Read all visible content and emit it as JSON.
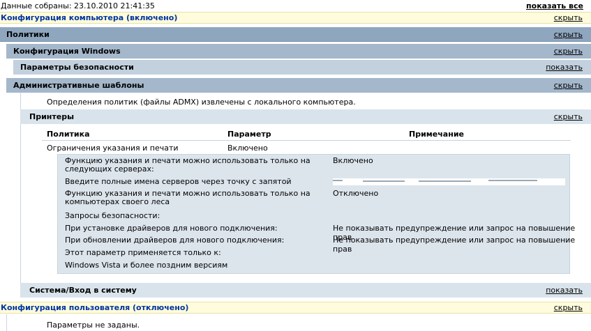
{
  "header": {
    "data_collected": "Данные собраны: 23.10.2010 21:41:35",
    "show_all": "показать все"
  },
  "computer_config": {
    "title": "Конфигурация компьютера (включено)",
    "toggle": "скрыть"
  },
  "policies": {
    "title": "Политики",
    "toggle": "скрыть"
  },
  "windows_config": {
    "title": "Конфигурация Windows",
    "toggle": "скрыть"
  },
  "security_settings": {
    "title": "Параметры безопасности",
    "toggle": "показать"
  },
  "admin_templates": {
    "title": "Административные шаблоны",
    "toggle": "скрыть",
    "note": "Определения политик (файлы ADMX) извлечены с локального компьютера."
  },
  "printers": {
    "title": "Принтеры",
    "toggle": "скрыть",
    "columns": [
      "Политика",
      "Параметр",
      "Примечание"
    ],
    "policy_row": {
      "policy": "Ограничения указания и печати",
      "value": "Включено"
    },
    "details": [
      {
        "label": "Функцию указания и печати можно использовать только на",
        "label2": "следующих серверах:",
        "value": "Включено"
      },
      {
        "label": "Введите полные имена серверов через точку с запятой",
        "label2": "",
        "value": ""
      },
      {
        "label": "Функцию указания и печати можно использовать только на",
        "label2": "компьютерах своего леса",
        "value": "Отключено"
      },
      {
        "label": "Запросы безопасности:",
        "label2": "",
        "value": ""
      },
      {
        "label": "При установке драйверов для нового подключения:",
        "label2": "",
        "value": "Не показывать предупреждение или запрос на повышение прав"
      },
      {
        "label": "При обновлении драйверов для нового подключения:",
        "label2": "",
        "value": "Не показывать предупреждение или запрос на повышение прав"
      },
      {
        "label": "Этот параметр применяется только к:",
        "label2": "",
        "value": ""
      },
      {
        "label": "Windows Vista и более поздним версиям",
        "label2": "",
        "value": ""
      }
    ]
  },
  "system_logon": {
    "title": "Система/Вход в систему",
    "toggle": "показать"
  },
  "user_config": {
    "title": "Конфигурация пользователя (отключено)",
    "toggle": "скрыть"
  },
  "user_note": "Параметры не заданы."
}
